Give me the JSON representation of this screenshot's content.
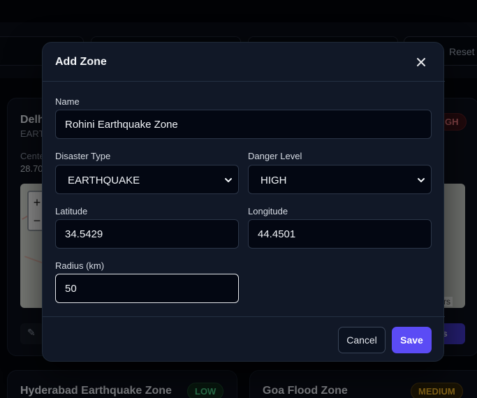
{
  "background": {
    "reset_label": "Reset",
    "cards": [
      {
        "title": "Delhi",
        "type": "EART",
        "center_label": "Cente",
        "center_value": "28.70",
        "badge": "GH",
        "zoom_in": "+",
        "zoom_out": "−",
        "attribution": "tors",
        "details_label": "ails"
      }
    ],
    "bottom_cards": [
      {
        "title": "Hyderabad Earthquake Zone",
        "badge": "LOW"
      },
      {
        "title": "Goa Flood Zone",
        "badge": "MEDIUM"
      }
    ]
  },
  "modal": {
    "title": "Add Zone",
    "close_icon": "close-icon",
    "fields": {
      "name": {
        "label": "Name",
        "value": "Rohini Earthquake Zone"
      },
      "disaster_type": {
        "label": "Disaster Type",
        "value": "EARTHQUAKE"
      },
      "danger_level": {
        "label": "Danger Level",
        "value": "HIGH"
      },
      "latitude": {
        "label": "Latitude",
        "value": "34.5429"
      },
      "longitude": {
        "label": "Longitude",
        "value": "44.4501"
      },
      "radius": {
        "label": "Radius (km)",
        "value": "50"
      }
    },
    "cancel_label": "Cancel",
    "save_label": "Save"
  },
  "colors": {
    "accent": "#5b4bf5",
    "badge_high": "#f07a80",
    "badge_low": "#4ed38b",
    "badge_medium": "#f0b429"
  }
}
